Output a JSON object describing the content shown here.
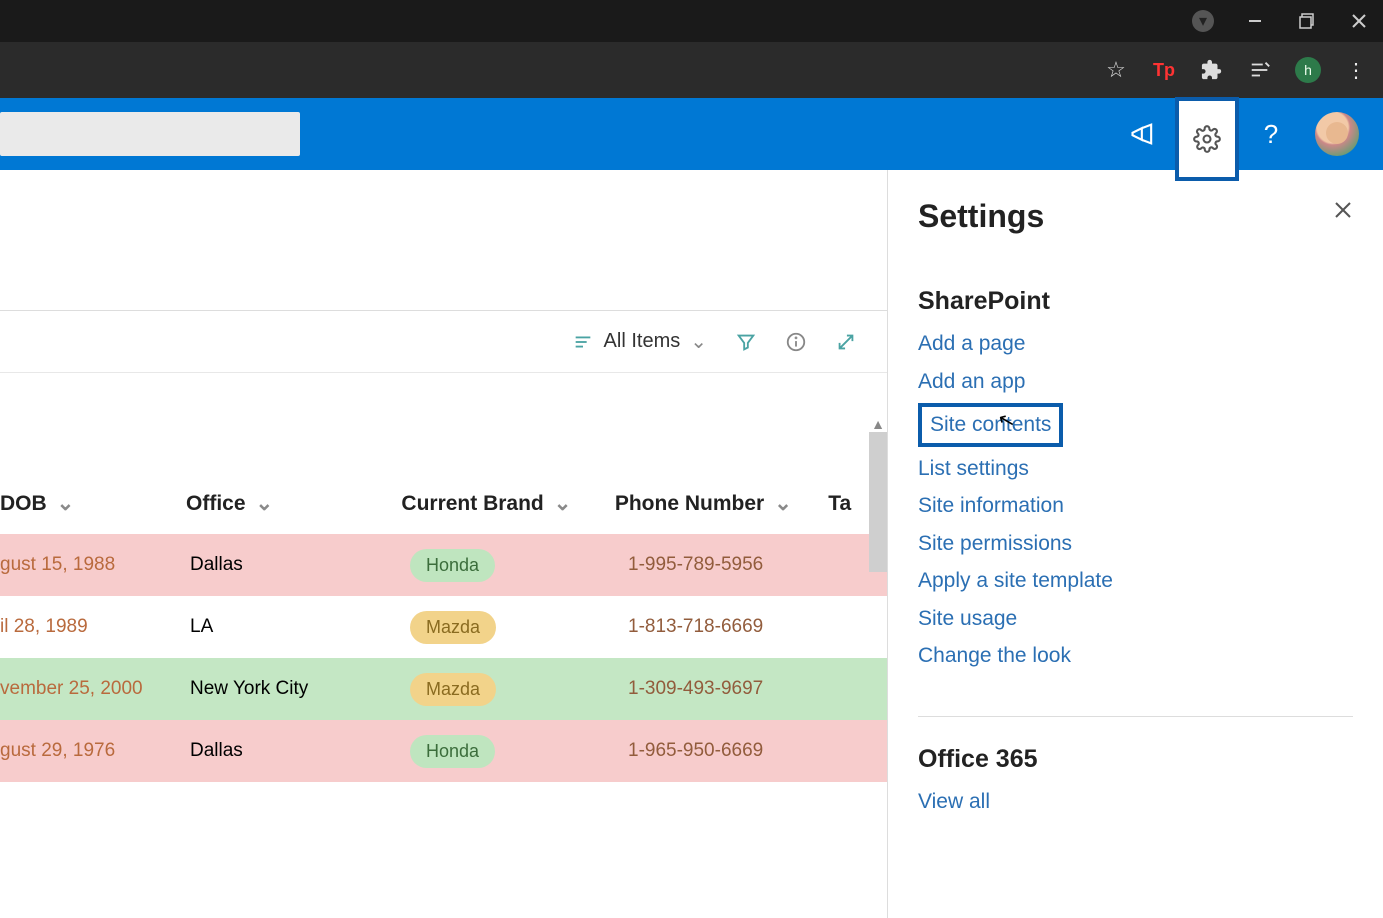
{
  "browser": {
    "profile_letter": "h",
    "tp_label": "Tp"
  },
  "header": {
    "search_placeholder": ""
  },
  "view_toolbar": {
    "view_name": "All Items"
  },
  "table": {
    "columns": {
      "dob": "DOB",
      "office": "Office",
      "brand": "Current Brand",
      "phone": "Phone Number",
      "tags": "Ta"
    },
    "rows": [
      {
        "dob": "gust 15, 1988",
        "office": "Dallas",
        "brand": "Honda",
        "brand_style": "honda",
        "phone": "1-995-789-5956",
        "bg": "pink"
      },
      {
        "dob": "il 28, 1989",
        "office": "LA",
        "brand": "Mazda",
        "brand_style": "mazda",
        "phone": "1-813-718-6669",
        "bg": "white"
      },
      {
        "dob": "vember 25, 2000",
        "office": "New York City",
        "brand": "Mazda",
        "brand_style": "mazda",
        "phone": "1-309-493-9697",
        "bg": "green"
      },
      {
        "dob": "gust 29, 1976",
        "office": "Dallas",
        "brand": "Honda",
        "brand_style": "honda",
        "phone": "1-965-950-6669",
        "bg": "pink"
      }
    ]
  },
  "settings": {
    "title": "Settings",
    "sharepoint_heading": "SharePoint",
    "links": [
      "Add a page",
      "Add an app",
      "Site contents",
      "List settings",
      "Site information",
      "Site permissions",
      "Apply a site template",
      "Site usage",
      "Change the look"
    ],
    "highlighted_link_index": 2,
    "office365_heading": "Office 365",
    "office365_link": "View all"
  }
}
